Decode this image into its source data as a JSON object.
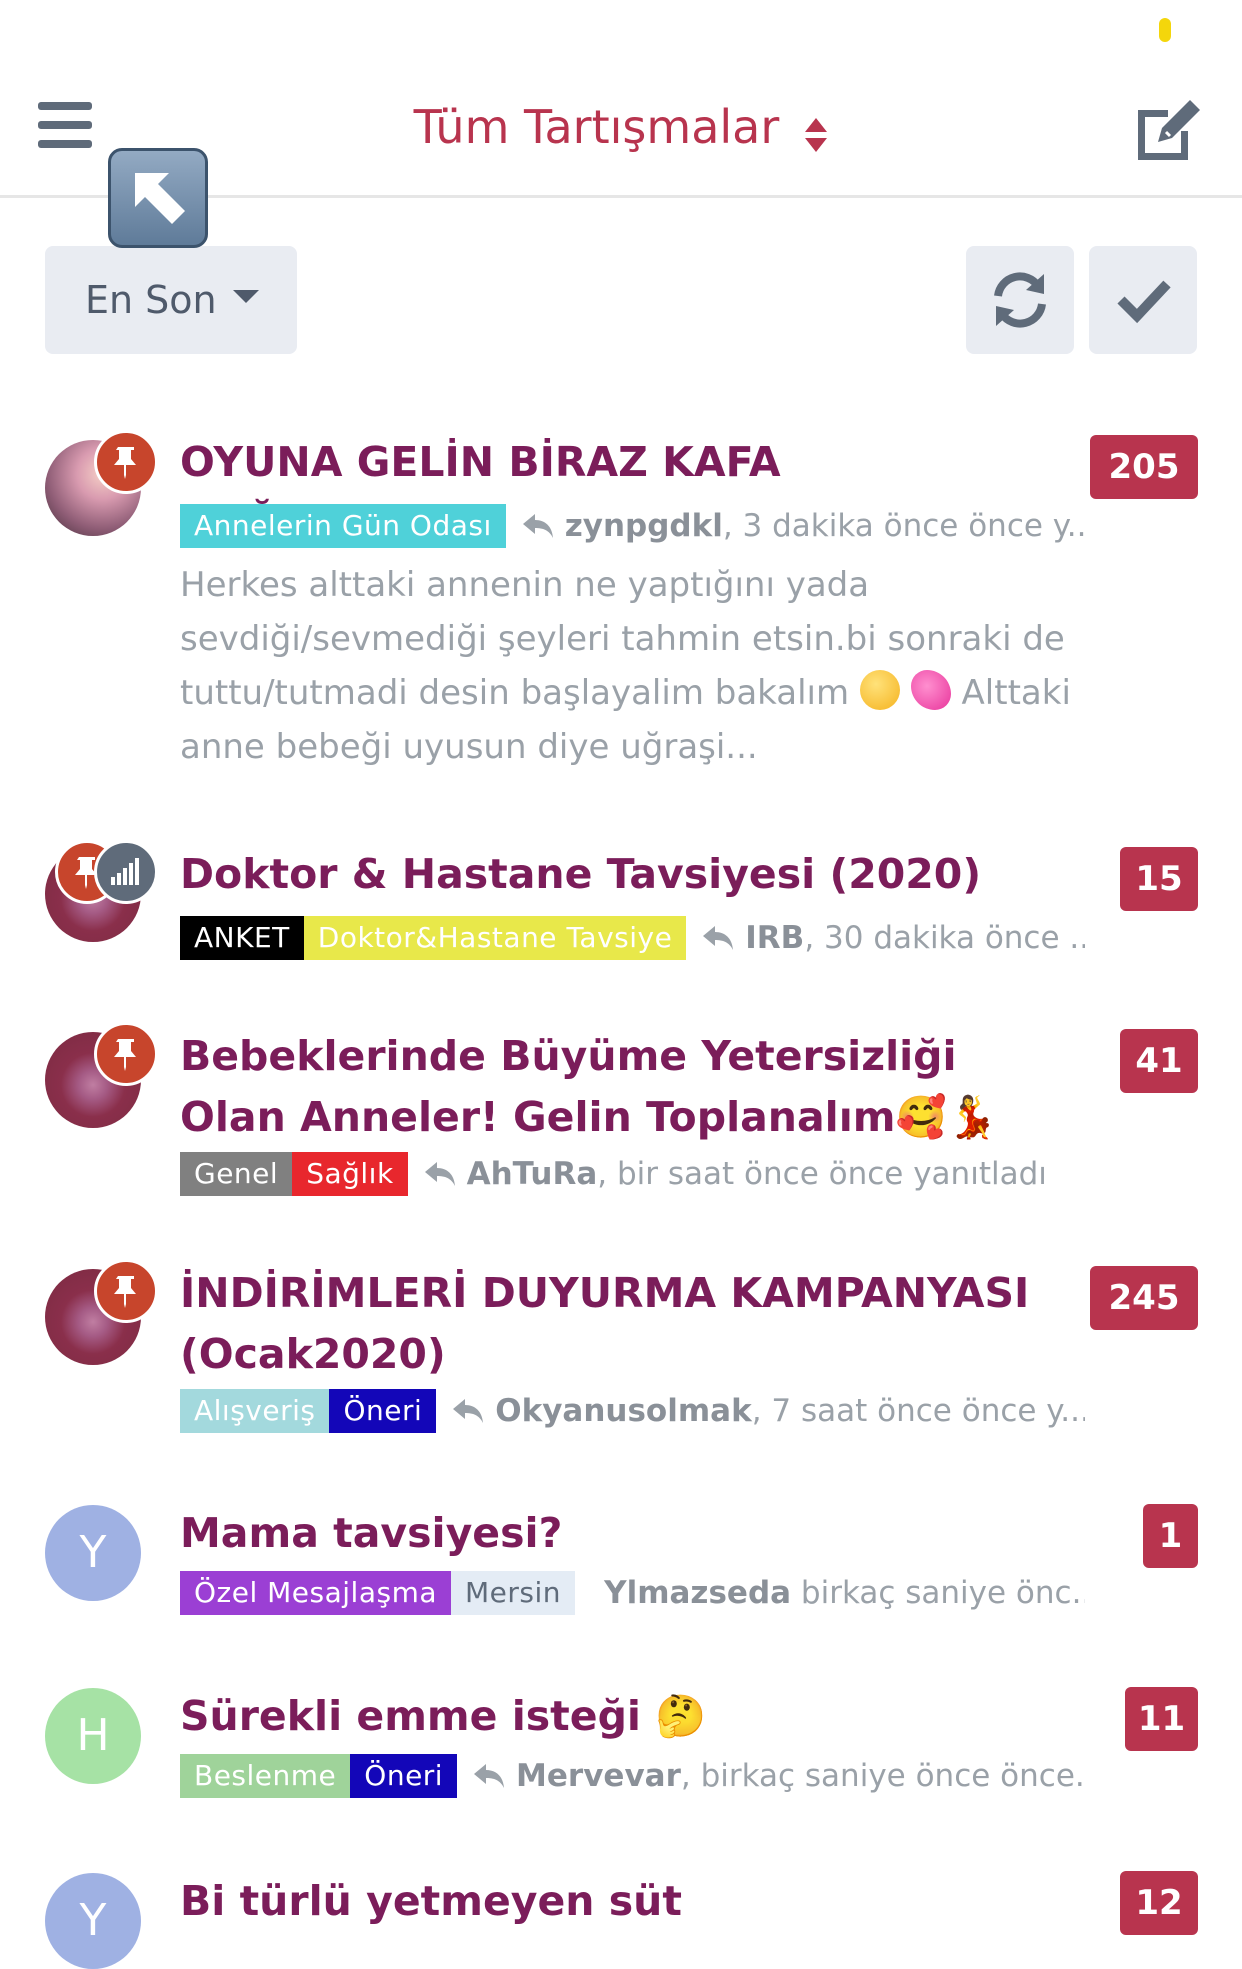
{
  "header": {
    "title": "Tüm Tartışmalar"
  },
  "toolbar": {
    "sort_label": "En Son"
  },
  "topics": [
    {
      "title": "OYUNA GELİN BİRAZ KAFA DAĞITALIM😂",
      "count": "205",
      "tags": [
        "Annelerin Gün Odası"
      ],
      "user": "zynpgdkl",
      "activity": ", 3 dakika önce önce y...",
      "excerpt_1": "Herkes alttaki annenin ne yaptığını yada sevdiği/sevmediği şeyleri tahmin etsin.bi sonraki de tuttu/tutmadi desin başlayalim bakalım",
      "excerpt_2": "Alttaki anne bebeği uyusun diye uğraşi..."
    },
    {
      "title": "Doktor & Hastane Tavsiyesi (2020)",
      "count": "15",
      "tags": [
        "ANKET",
        "Doktor&Hastane Tavsiye"
      ],
      "user": "IRB",
      "activity": ", 30 dakika önce ..."
    },
    {
      "title": "Bebeklerinde Büyüme Yetersizliği Olan Anneler! Gelin Toplanalım🥰💃",
      "count": "41",
      "tags": [
        "Genel",
        "Sağlık"
      ],
      "user": "AhTuRa",
      "activity": ", bir saat önce önce yanıtladı"
    },
    {
      "title": "İNDİRİMLERİ DUYURMA KAMPANYASI (Ocak2020)",
      "count": "245",
      "tags": [
        "Alışveriş",
        "Öneri"
      ],
      "user": "Okyanusolmak",
      "activity": ", 7 saat önce önce y..."
    },
    {
      "title": "Mama tavsiyesi?",
      "count": "1",
      "avatar_letter": "Y",
      "tags": [
        "Özel Mesajlaşma",
        "Mersin"
      ],
      "user": "Ylmazseda",
      "activity": " birkaç saniye önc..."
    },
    {
      "title": "Sürekli emme isteği 🤔",
      "count": "11",
      "avatar_letter": "H",
      "tags": [
        "Beslenme",
        "Öneri"
      ],
      "user": "Mervevar",
      "activity": ", birkaç saniye önce önce..."
    },
    {
      "title": "Bi türlü yetmeyen süt",
      "count": "12",
      "avatar_letter": "Y"
    }
  ],
  "colors": {
    "accent": "#b8344e",
    "topic_title": "#7b1d5a",
    "pin": "#c7452c",
    "tag_annelerin": "#4fd1d9",
    "tag_anket": "#000000",
    "tag_doktor": "#e8e84a",
    "tag_genel": "#808080",
    "tag_saglik": "#e8272d",
    "tag_alisveris": "#a3d9dd",
    "tag_oneri": "#1306b8",
    "tag_ozel": "#9b3fd4",
    "tag_mersin": "#e4ecf5",
    "tag_beslenme": "#9fd39a"
  },
  "icons": [
    "menu-icon",
    "sort-arrows-icon",
    "compose-icon",
    "back-arrow-icon",
    "caret-down-icon",
    "refresh-icon",
    "check-icon",
    "pin-icon",
    "poll-icon",
    "reply-icon"
  ]
}
